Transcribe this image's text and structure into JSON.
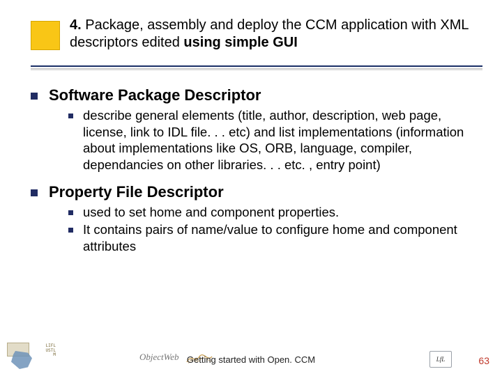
{
  "slide": {
    "title_plain_prefix": "4. ",
    "title_line": "Package, assembly and deploy the CCM application with XML descriptors edited ",
    "title_bold_tail": "using simple GUI"
  },
  "sections": [
    {
      "heading": "Software Package Descriptor",
      "items": [
        "describe general elements (title, author, description, web page, license, link to IDL file. . . etc) and list implementations (information about implementations like OS, ORB, language, compiler, dependancies on other libraries. . . etc. , entry point)"
      ]
    },
    {
      "heading": "Property File Descriptor",
      "items": [
        "used to set home and component properties.",
        "It contains pairs of name/value to configure home and component attributes"
      ]
    }
  ],
  "footer": {
    "center_text": "Getting started with Open. CCM",
    "objectweb_label": "ObjectWeb",
    "right_logo_text": "LfL",
    "left_tag_lines": "LIFL\nUSTL\nM",
    "page_number": "63"
  }
}
